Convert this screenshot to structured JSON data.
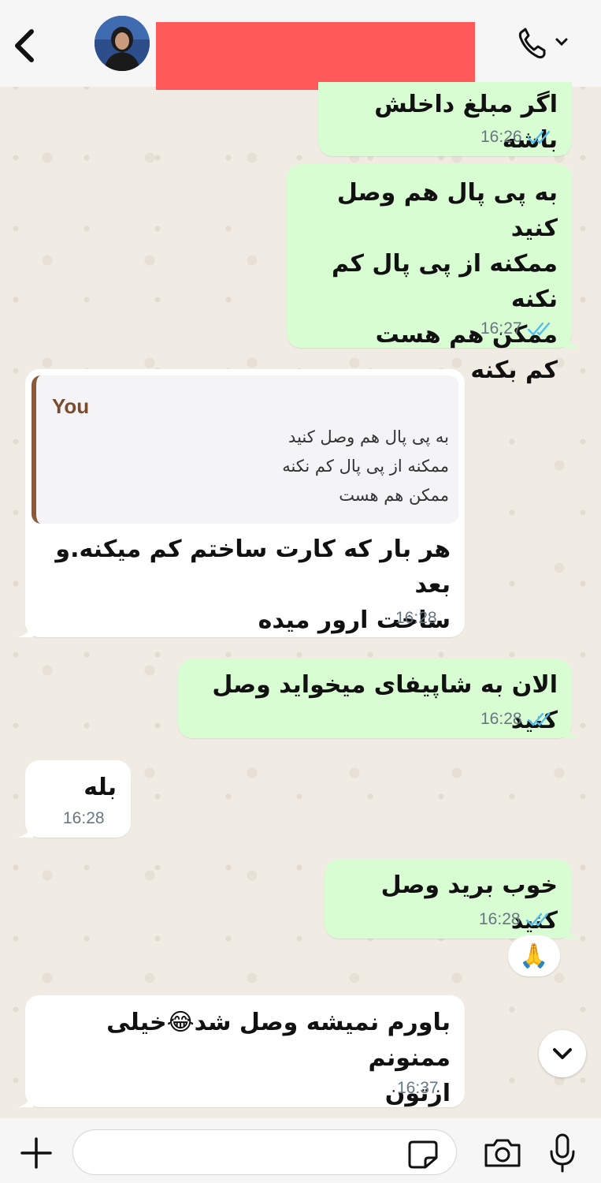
{
  "header": {
    "contact_name": "",
    "back_icon": "chevron-left-icon",
    "call_icon": "phone-icon"
  },
  "messages": [
    {
      "direction": "out",
      "text": "اگر مبلغ داخلش باشه",
      "time": "16:26",
      "status": "read"
    },
    {
      "direction": "out",
      "text": "به پی پال هم وصل کنید\nممکنه از پی پال کم نکنه\nممکن هم هست\nکم بکنه",
      "time": "16:27",
      "status": "read"
    },
    {
      "direction": "in",
      "quote_author": "You",
      "quote_text": "به پی پال هم وصل کنید\nممکنه از پی پال کم نکنه\nممکن هم هست",
      "text": "هر بار که کارت ساختم کم میکنه.و بعد\nساخت ارور میده",
      "time": "16:28"
    },
    {
      "direction": "out",
      "text": "الان به شاپیفای میخواید وصل کنید",
      "time": "16:28",
      "status": "read"
    },
    {
      "direction": "in",
      "text": "بله",
      "time": "16:28"
    },
    {
      "direction": "out",
      "text": "خوب برید وصل کنید",
      "time": "16:28",
      "status": "read",
      "reaction": "🙏"
    },
    {
      "direction": "in",
      "text": "باورم نمیشه وصل شد😂خیلی ممنونم\nازتون",
      "time": "16:37"
    }
  ],
  "composer": {
    "placeholder": "",
    "icons": [
      "plus-icon",
      "sticker-icon",
      "camera-icon",
      "microphone-icon"
    ]
  },
  "colors": {
    "outgoing_bubble": "#d9fdd3",
    "incoming_bubble": "#ffffff",
    "read_ticks": "#53bdeb",
    "quote_bar": "#8a5a3b"
  }
}
